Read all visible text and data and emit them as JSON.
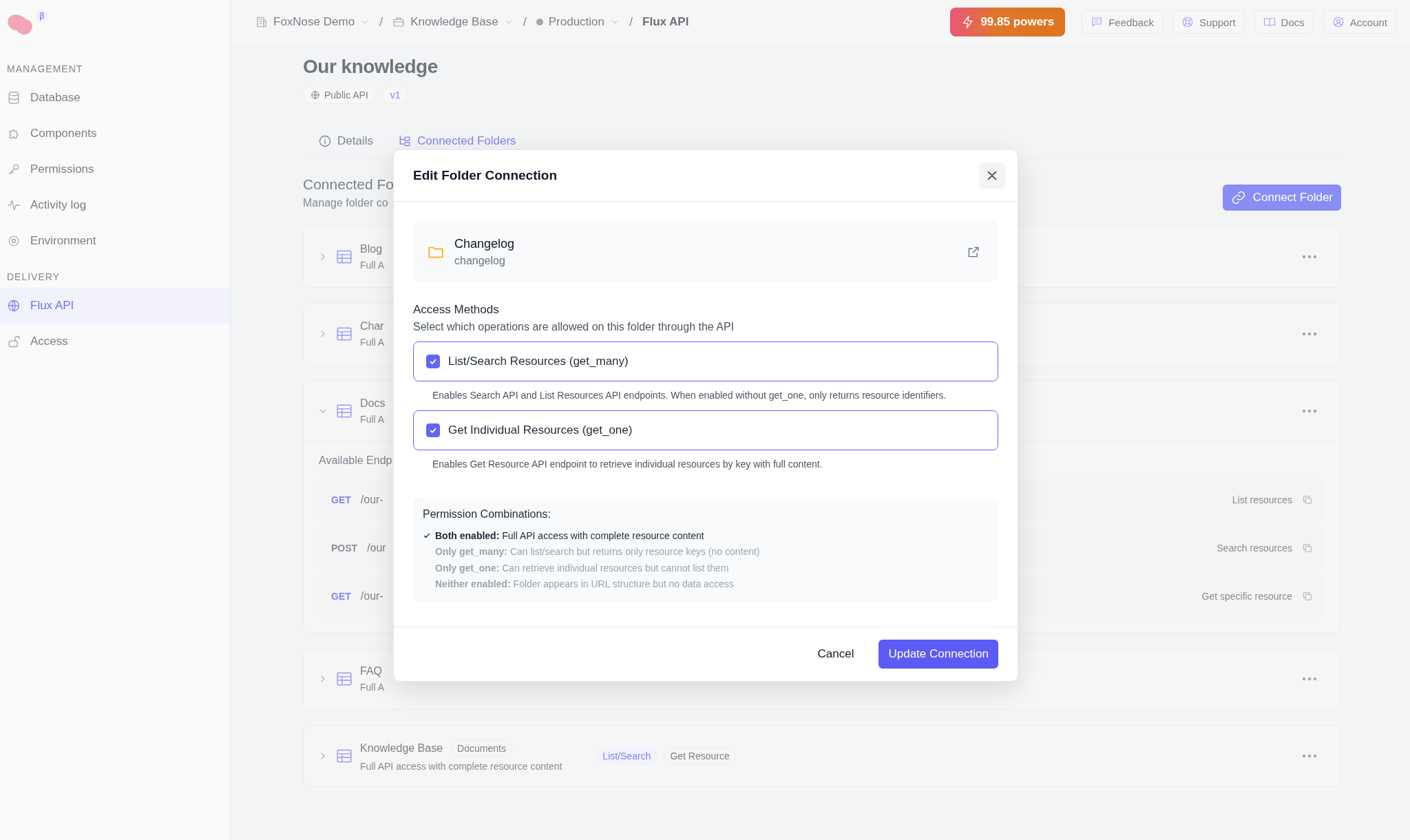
{
  "sidebar": {
    "beta_badge": "β",
    "sections": [
      {
        "label": "MANAGEMENT",
        "items": [
          {
            "label": "Database",
            "selected": false
          },
          {
            "label": "Components",
            "selected": false
          },
          {
            "label": "Permissions",
            "selected": false
          },
          {
            "label": "Activity log",
            "selected": false
          },
          {
            "label": "Environment",
            "selected": false
          }
        ]
      },
      {
        "label": "DELIVERY",
        "items": [
          {
            "label": "Flux API",
            "selected": true
          },
          {
            "label": "Access",
            "selected": false
          }
        ]
      }
    ]
  },
  "topbar": {
    "breadcrumbs": [
      {
        "label": "FoxNose Demo",
        "dropdown": true
      },
      {
        "label": "Knowledge Base",
        "dropdown": true
      },
      {
        "label": "Production",
        "dropdown": true
      },
      {
        "label": "Flux API",
        "dropdown": false
      }
    ],
    "separator": "/",
    "powers": "99.85 powers",
    "buttons": [
      "Feedback",
      "Support",
      "Docs",
      "Account"
    ]
  },
  "page": {
    "title": "Our knowledge",
    "badges": [
      "Public API",
      "v1"
    ],
    "tabs": [
      {
        "label": "Details",
        "selected": false
      },
      {
        "label": "Connected Folders",
        "selected": true
      }
    ],
    "section_title": "Connected Fo",
    "section_subtitle": "Manage folder co",
    "connect_button": "Connect Folder",
    "folders": [
      {
        "name": "Blog",
        "subtitle": "Full A",
        "expanded": false
      },
      {
        "name": "Char",
        "subtitle": "Full A",
        "expanded": false
      },
      {
        "name": "Docs",
        "subtitle": "Full A",
        "expanded": true,
        "endpoints_title": "Available Endp",
        "endpoints": [
          {
            "method": "GET",
            "color": "#8284f2",
            "path": "/our-",
            "description": "List resources"
          },
          {
            "method": "POST",
            "color": "#8a8f99",
            "path": "/our",
            "description": "Search resources"
          },
          {
            "method": "GET",
            "color": "#8284f2",
            "path": "/our-",
            "description": "Get specific resource"
          }
        ]
      },
      {
        "name": "FAQ",
        "subtitle": "Full A",
        "expanded": false
      },
      {
        "name": "Knowledge Base",
        "badge": "Documents",
        "subtitle": "Full API access with complete resource content",
        "expanded": false,
        "tags": [
          {
            "label": "List/Search",
            "kind": "active"
          },
          {
            "label": "Get Resource",
            "kind": "plain"
          }
        ]
      }
    ]
  },
  "modal": {
    "title": "Edit Folder Connection",
    "folder": {
      "name": "Changelog",
      "slug": "changelog"
    },
    "section_title": "Access Methods",
    "section_subtitle": "Select which operations are allowed on this folder through the API",
    "options": [
      {
        "label": "List/Search Resources (get_many)",
        "checked": true,
        "description": "Enables Search API and List Resources API endpoints. When enabled without get_one, only returns resource identifiers."
      },
      {
        "label": "Get Individual Resources (get_one)",
        "checked": true,
        "description": "Enables Get Resource API endpoint to retrieve individual resources by key with full content."
      }
    ],
    "combinations": {
      "title": "Permission Combinations:",
      "items": [
        {
          "text": "**Both enabled:** Full API access with complete resource content",
          "active": true
        },
        {
          "text": "**Only get_many:** Can list/search but returns only resource keys (no content)",
          "active": false
        },
        {
          "text": "**Only get_one:** Can retrieve individual resources but cannot list them",
          "active": false
        },
        {
          "text": "**Neither enabled:** Folder appears in URL structure but no data access",
          "active": false
        }
      ]
    },
    "buttons": [
      {
        "label": "Cancel",
        "kind": "secondary"
      },
      {
        "label": "Update Connection",
        "kind": "primary"
      }
    ]
  }
}
